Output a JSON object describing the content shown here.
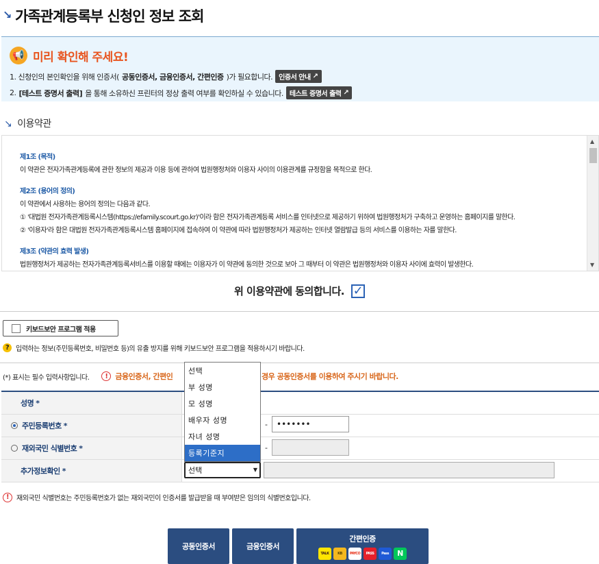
{
  "page": {
    "title": "가족관계등록부 신청인 정보 조회"
  },
  "notice": {
    "title": "미리 확인해 주세요!",
    "line1_pre": "1. 신청인의 본인확인을 위해 인증서(",
    "line1_bold": "공동인증서, 금융인증서, 간편인증",
    "line1_post": ")가 필요합니다.",
    "line1_button": "인증서 안내",
    "line2_pre": "2.",
    "line2_bold": "[테스트 증명서 출력]",
    "line2_post": "을 통해 소유하신 프린터의 정상 출력 여부를 확인하실 수 있습니다.",
    "line2_button": "테스트 증명서 출력"
  },
  "terms": {
    "section_title": "이용약관",
    "art1_title": "제1조 (목적)",
    "art1_text": "이 약관은 전자가족관계등록에 관한 정보의 제공과 이용 등에 관하여 법원행정처와 이용자 사이의 이용관계를 규정함을 목적으로 한다.",
    "art2_title": "제2조 (용어의 정의)",
    "art2_text": "이 약관에서 사용하는 용어의 정의는 다음과 같다.",
    "art2_item1": "① '대법원 전자가족관계등록시스템(https://efamily.scourt.go.kr)'이라 함은 전자가족관계등록 서비스를 인터넷으로 제공하기 위하여 법원행정처가 구축하고 운영하는 홈페이지를 말한다.",
    "art2_item2": "② '이용자'라 함은 대법원 전자가족관계등록시스템 홈페이지에 접속하여 이 약관에 따라 법원행정처가 제공하는 인터넷 열람발급 등의 서비스를 이용하는 자를 말한다.",
    "art3_title": "제3조 (약관의 효력 발생)",
    "art3_text": "법원행정처가 제공하는 전자가족관계등록서비스를 이용할 때에는 이용자가 이 약관에 동의한 것으로 보아 그 때부터 이 약관은 법원행정처와 이용자 사이에 효력이 발생한다."
  },
  "agree": {
    "label": "위 이용약관에 동의합니다.",
    "checked": "✓"
  },
  "keyboard": {
    "button_label": "키보드보안 프로그램 적용",
    "help_text": "입력하는 정보(주민등록번호, 비밀번호 등)의 유출 방지를 위해 키보드보안 프로그램을 적용하시기 바랍니다."
  },
  "required": {
    "note": "(*) 표시는 필수 입력사항입니다.",
    "warn_head": "금융인증서, 간편인",
    "warn_tail": "경우 공동인증서를 이용하여 주시기 바랍니다."
  },
  "form": {
    "name_label": "성명",
    "rrn_label": "주민등록번호",
    "foreign_label": "재외국민 식별번호",
    "extra_label": "추가정보확인",
    "star": "*",
    "rrn_back_value": "•••••••",
    "dash": "-"
  },
  "dropdown": {
    "selected": "선택",
    "options": [
      "선택",
      "부 성명",
      "모 성명",
      "배우자 성명",
      "자녀 성명",
      "등록기준지"
    ]
  },
  "footnote": "재외국민 식별번호는 주민등록번호가 없는 재외국민이 인증서를 발급받을 때 부여받은 임의의 식별번호입니다.",
  "buttons": {
    "joint": "공동인증서",
    "financial": "금융인증서",
    "simple": "간편인증"
  },
  "logos": [
    "TALK",
    "KB",
    "PAYCO",
    "PASS",
    "Pass",
    "N"
  ],
  "colors": {
    "primary": "#2b4d80",
    "accent": "#e8541e",
    "warn": "#d8661a"
  }
}
